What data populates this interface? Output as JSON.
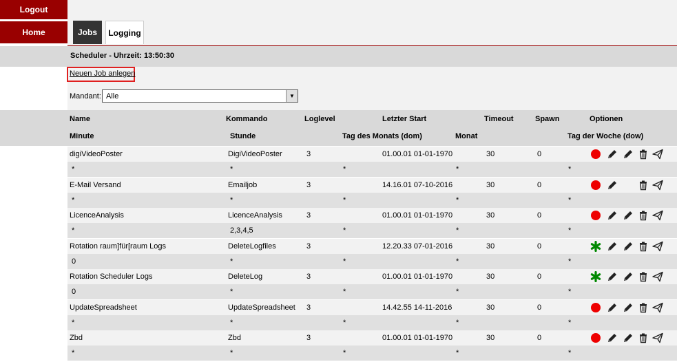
{
  "nav": {
    "logout": "Logout",
    "home": "Home"
  },
  "tabs": [
    {
      "label": "Jobs"
    },
    {
      "label": "Logging"
    }
  ],
  "scheduler": {
    "title": "Scheduler  -  Uhrzeit: 13:50:30"
  },
  "new_job": {
    "label": "Neuen Job anlegen"
  },
  "mandant": {
    "label": "Mandant:",
    "value": "Alle"
  },
  "headers": {
    "name": "Name",
    "kommando": "Kommando",
    "loglevel": "Loglevel",
    "letzter_start": "Letzter Start",
    "timeout": "Timeout",
    "spawn": "Spawn",
    "optionen": "Optionen",
    "minute": "Minute",
    "stunde": "Stunde",
    "tag_monat": "Tag des Monats (dom)",
    "monat": "Monat",
    "tag_woche": "Tag der Woche (dow)"
  },
  "jobs": [
    {
      "name": "digiVideoPoster",
      "kommando": "DigiVideoPoster",
      "loglevel": "3",
      "letzter_start": "01.00.01 01-01-1970",
      "timeout": "30",
      "spawn": "0",
      "status": "stopped",
      "edit2": true,
      "minute": "*",
      "stunde": "*",
      "dom": "*",
      "monat": "*",
      "dow": "*"
    },
    {
      "name": "E-Mail Versand",
      "kommando": "Emailjob",
      "loglevel": "3",
      "letzter_start": "14.16.01 07-10-2016",
      "timeout": "30",
      "spawn": "0",
      "status": "stopped",
      "edit2": false,
      "minute": "*",
      "stunde": "*",
      "dom": "*",
      "monat": "*",
      "dow": "*"
    },
    {
      "name": "LicenceAnalysis",
      "kommando": "LicenceAnalysis",
      "loglevel": "3",
      "letzter_start": "01.00.01 01-01-1970",
      "timeout": "30",
      "spawn": "0",
      "status": "stopped",
      "edit2": true,
      "minute": "*",
      "stunde": "2,3,4,5",
      "dom": "*",
      "monat": "*",
      "dow": "*"
    },
    {
      "name": "Rotation raum]für[raum Logs",
      "kommando": "DeleteLogfiles",
      "loglevel": "3",
      "letzter_start": "12.20.33 07-01-2016",
      "timeout": "30",
      "spawn": "0",
      "status": "active",
      "edit2": true,
      "minute": "0",
      "stunde": "*",
      "dom": "*",
      "monat": "*",
      "dow": "*"
    },
    {
      "name": "Rotation Scheduler Logs",
      "kommando": "DeleteLog",
      "loglevel": "3",
      "letzter_start": "01.00.01 01-01-1970",
      "timeout": "30",
      "spawn": "0",
      "status": "active",
      "edit2": true,
      "minute": "0",
      "stunde": "*",
      "dom": "*",
      "monat": "*",
      "dow": "*"
    },
    {
      "name": "UpdateSpreadsheet",
      "kommando": "UpdateSpreadsheet",
      "loglevel": "3",
      "letzter_start": "14.42.55 14-11-2016",
      "timeout": "30",
      "spawn": "0",
      "status": "stopped",
      "edit2": true,
      "minute": "*",
      "stunde": "*",
      "dom": "*",
      "monat": "*",
      "dow": "*"
    },
    {
      "name": "Zbd",
      "kommando": "Zbd",
      "loglevel": "3",
      "letzter_start": "01.00.01 01-01-1970",
      "timeout": "30",
      "spawn": "0",
      "status": "stopped",
      "edit2": true,
      "minute": "*",
      "stunde": "*",
      "dom": "*",
      "monat": "*",
      "dow": "*"
    }
  ],
  "colors": {
    "nav_bg": "#990000",
    "stopped": "#ee0000",
    "active": "#008800",
    "highlight_box": "#e02020"
  },
  "icons": {
    "stopped": "red-circle-icon",
    "active": "green-asterisk-icon",
    "edit": "pencil-icon",
    "delete": "trash-icon",
    "run": "paper-plane-icon"
  }
}
